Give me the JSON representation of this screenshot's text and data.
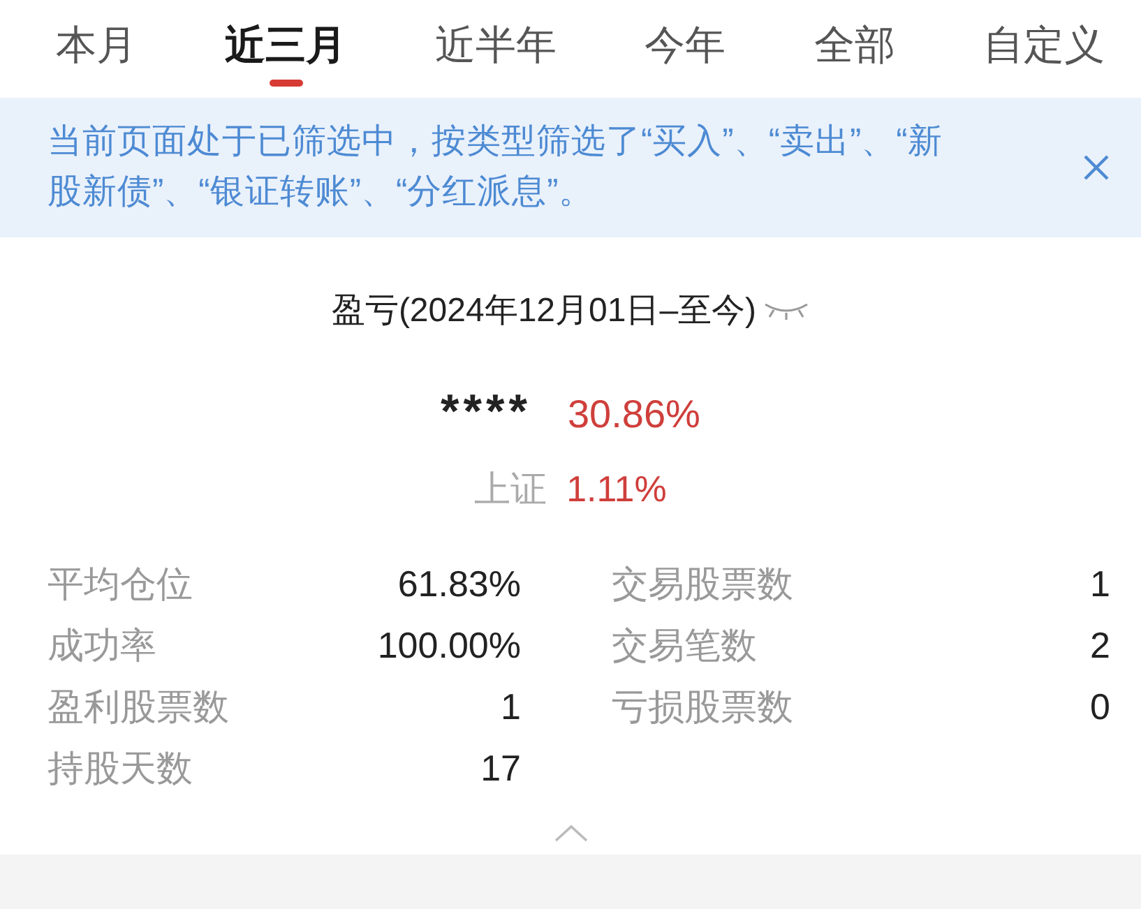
{
  "tabs": [
    {
      "label": "本月",
      "selected": false
    },
    {
      "label": "近三月",
      "selected": true
    },
    {
      "label": "近半年",
      "selected": false
    },
    {
      "label": "今年",
      "selected": false
    },
    {
      "label": "全部",
      "selected": false
    },
    {
      "label": "自定义",
      "selected": false
    }
  ],
  "filter_banner": {
    "text": "当前页面处于已筛选中，按类型筛选了“买入”、“卖出”、“新股新债”、“银证转账”、“分红派息”。"
  },
  "summary": {
    "title": "盈亏(2024年12月01日–至今)",
    "amount": "****",
    "return": "30.86%",
    "benchmark_label": "上证",
    "benchmark_value": "1.11%"
  },
  "stats": {
    "left": [
      {
        "label": "平均仓位",
        "value": "61.83%"
      },
      {
        "label": "成功率",
        "value": "100.00%"
      },
      {
        "label": "盈利股票数",
        "value": "1"
      },
      {
        "label": "持股天数",
        "value": "17"
      }
    ],
    "right": [
      {
        "label": "交易股票数",
        "value": "1"
      },
      {
        "label": "交易笔数",
        "value": "2"
      },
      {
        "label": "亏损股票数",
        "value": "0"
      }
    ]
  }
}
